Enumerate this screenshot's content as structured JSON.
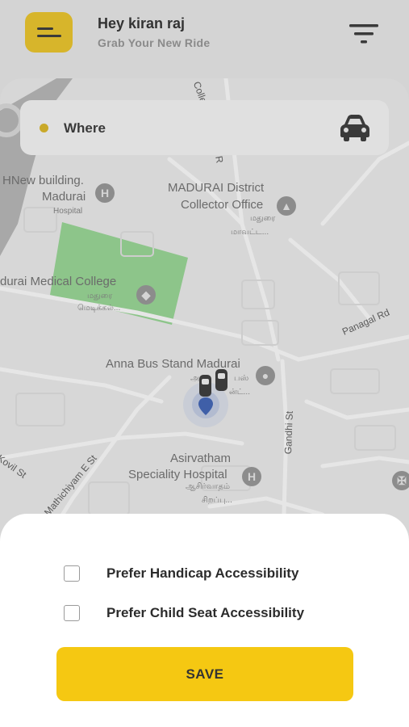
{
  "header": {
    "greeting": "Hey kiran raj",
    "subtitle": "Grab Your New Ride",
    "menu_icon": "menu-icon",
    "filter_icon": "filter-icon"
  },
  "search": {
    "label": "Where",
    "car_icon": "car-icon"
  },
  "map": {
    "labels": {
      "hnew": "HNew building.",
      "hnew2": "Madurai",
      "hospital": "Hospital",
      "district1": "MADURAI District",
      "district2": "Collector Office",
      "district_ta1": "மதுரை",
      "district_ta2": "மாவட்ட...",
      "college": "durai Medical College",
      "college_ta1": "மதுரை",
      "college_ta2": "மெடிக்கல்...",
      "bus_stand": "Anna Bus Stand Madurai",
      "bus_ta1": "அ",
      "bus_ta2": "பஸ்",
      "bus_ta3": "ன்ட்...",
      "panagal": "Panagal Rd",
      "gandhi": "Gandhi St",
      "mathichiyam": "Mathichiyam E St",
      "kovil": "Kovil St",
      "asirvatham1": "Asirvatham",
      "asirvatham2": "Speciality Hospital",
      "asirvatham_ta1": "ஆசிர்வாதம்",
      "asirvatham_ta2": "சிறப்பு...",
      "coller": "Coller",
      "p_road": "R"
    }
  },
  "sheet": {
    "options": [
      {
        "label": "Prefer Handicap Accessibility",
        "checked": false
      },
      {
        "label": "Prefer Child Seat Accessibility",
        "checked": false
      }
    ],
    "save_label": "SAVE"
  },
  "colors": {
    "accent": "#f5c812",
    "menu_button": "#d7b52b",
    "where_dot": "#c9a92a"
  }
}
